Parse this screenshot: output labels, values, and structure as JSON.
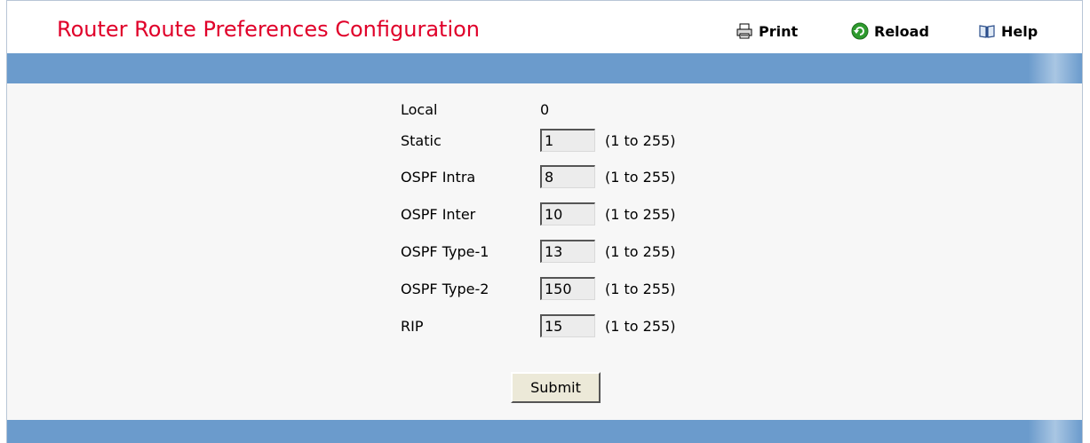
{
  "header": {
    "title": "Router Route Preferences Configuration",
    "links": {
      "print": {
        "label": "Print",
        "icon": "printer-icon"
      },
      "reload": {
        "label": "Reload",
        "icon": "reload-icon"
      },
      "help": {
        "label": "Help",
        "icon": "book-icon"
      }
    }
  },
  "form": {
    "local": {
      "label": "Local",
      "value": "0"
    },
    "fields": [
      {
        "label": "Static",
        "value": "1",
        "range": "(1 to 255)"
      },
      {
        "label": "OSPF Intra",
        "value": "8",
        "range": "(1 to 255)"
      },
      {
        "label": "OSPF Inter",
        "value": "10",
        "range": "(1 to 255)"
      },
      {
        "label": "OSPF Type-1",
        "value": "13",
        "range": "(1 to 255)"
      },
      {
        "label": "OSPF Type-2",
        "value": "150",
        "range": "(1 to 255)"
      },
      {
        "label": "RIP",
        "value": "15",
        "range": "(1 to 255)"
      }
    ],
    "submit_label": "Submit"
  },
  "colors": {
    "title": "#e0002a",
    "bar": "#6b9bcc",
    "content_bg": "#f7f7f7"
  }
}
